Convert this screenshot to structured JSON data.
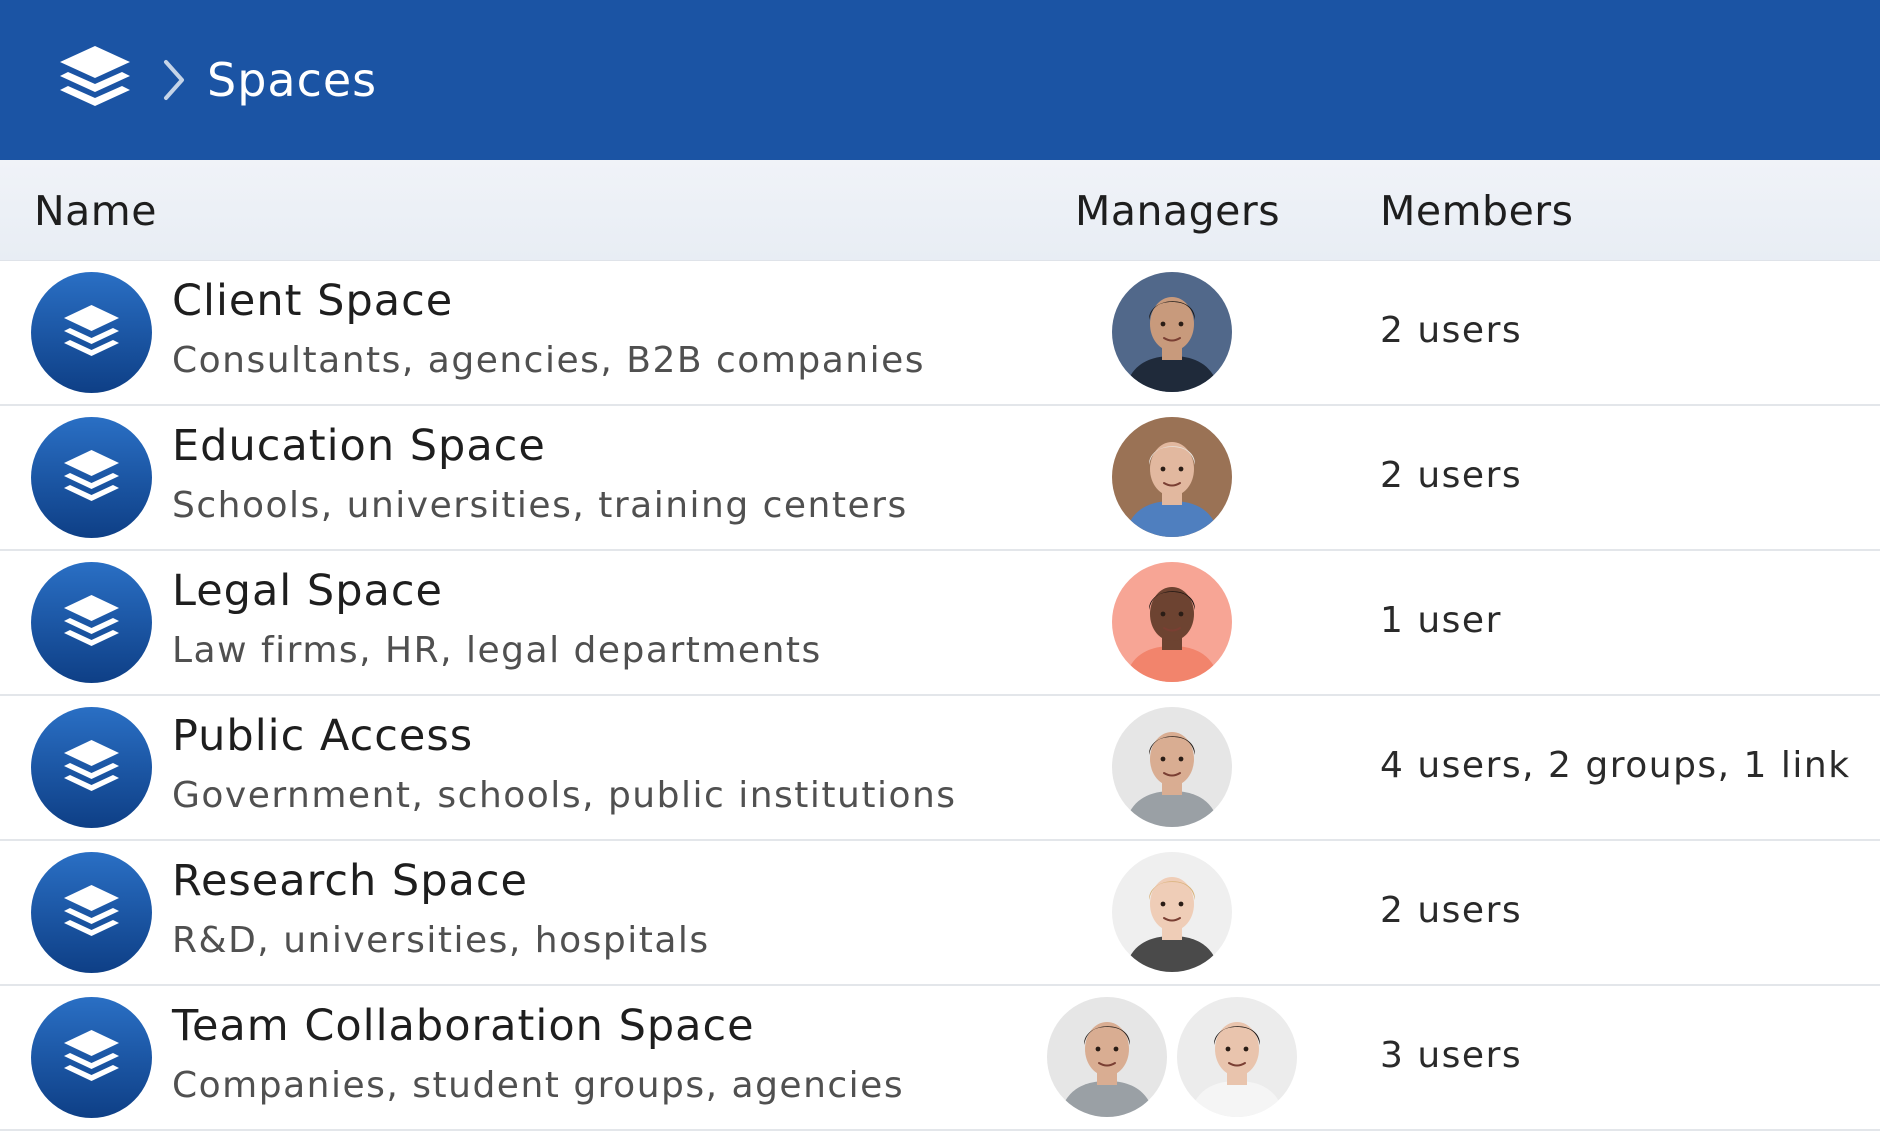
{
  "breadcrumb": {
    "current": "Spaces"
  },
  "columns": {
    "name": "Name",
    "managers": "Managers",
    "members": "Members"
  },
  "colors": {
    "header": "#1b54a4",
    "icon_top": "#2a6fc4",
    "icon_bottom": "#0e3f86"
  },
  "rows": [
    {
      "title": "Client Space",
      "subtitle": "Consultants, agencies, B2B companies",
      "members": "2 users",
      "managers": [
        {
          "skin": "#c89a7c",
          "hair": "#1d1a18",
          "shirt": "#1f2a3a",
          "bg": "#51688a"
        }
      ]
    },
    {
      "title": "Education Space",
      "subtitle": "Schools, universities, training centers",
      "members": "2 users",
      "managers": [
        {
          "skin": "#e2b89f",
          "hair": "#e8e4df",
          "shirt": "#4f7fbf",
          "bg": "#9a7255"
        }
      ]
    },
    {
      "title": "Legal Space",
      "subtitle": "Law firms, HR, legal departments",
      "members": "1 user",
      "managers": [
        {
          "skin": "#6d4331",
          "hair": "#1c1410",
          "shirt": "#f2846c",
          "bg": "#f7a595"
        }
      ]
    },
    {
      "title": "Public Access",
      "subtitle": "Government, schools, public institutions",
      "members": "4 users, 2 groups, 1 link",
      "managers": [
        {
          "skin": "#d9ad92",
          "hair": "#2a211c",
          "shirt": "#9aa0a5",
          "bg": "#e6e6e6"
        }
      ]
    },
    {
      "title": "Research Space",
      "subtitle": "R&D, universities, hospitals",
      "members": "2 users",
      "managers": [
        {
          "skin": "#efcdb7",
          "hair": "#d9b27a",
          "shirt": "#4a4a4a",
          "bg": "#efefef"
        }
      ]
    },
    {
      "title": "Team Collaboration Space",
      "subtitle": "Companies, student groups, agencies",
      "members": "3 users",
      "managers": [
        {
          "skin": "#d9ad92",
          "hair": "#2a211c",
          "shirt": "#9aa0a5",
          "bg": "#e6e6e6"
        },
        {
          "skin": "#e9c4ad",
          "hair": "#1a1412",
          "shirt": "#f5f5f5",
          "bg": "#ececec"
        }
      ]
    }
  ]
}
